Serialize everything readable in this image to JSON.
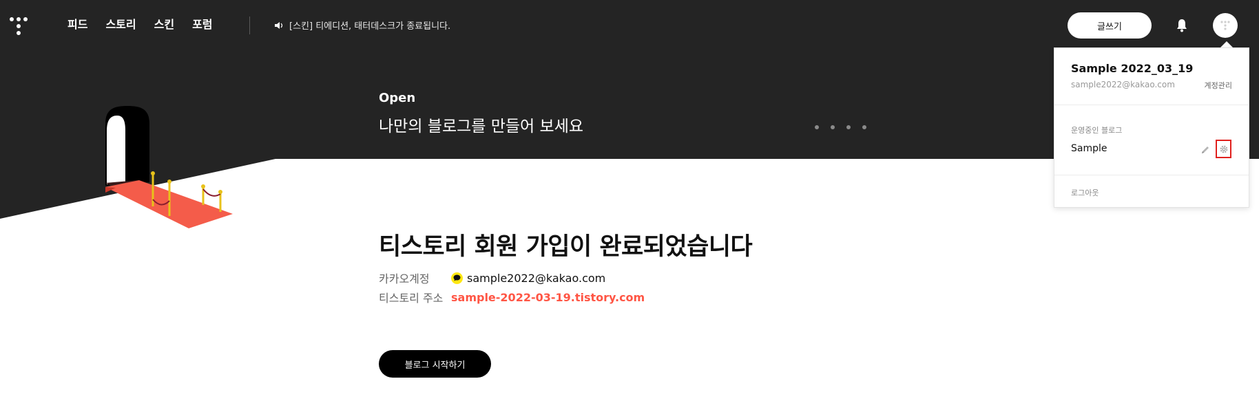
{
  "nav": {
    "items": [
      "피드",
      "스토리",
      "스킨",
      "포럼"
    ]
  },
  "notice": {
    "text": "[스킨] 티에디션, 태터데스크가 종료됩니다."
  },
  "header": {
    "write_label": "글쓰기"
  },
  "hero": {
    "kicker": "Open",
    "title": "나만의 블로그를 만들어 보세요"
  },
  "main": {
    "title": "티스토리 회원 가입이 완료되었습니다",
    "kakao_label": "카카오계정",
    "kakao_value": "sample2022@kakao.com",
    "address_label": "티스토리 주소",
    "address_value": "sample-2022-03-19.tistory.com",
    "start_label": "블로그 시작하기"
  },
  "dropdown": {
    "user_name": "Sample 2022_03_19",
    "user_email": "sample2022@kakao.com",
    "manage_label": "계정관리",
    "section_label": "운영중인 블로그",
    "blog_name": "Sample",
    "logout_label": "로그아웃"
  },
  "icons": {
    "logo": "tistory-logo-icon",
    "speaker": "speaker-icon",
    "bell": "bell-icon",
    "profile": "profile-icon",
    "pencil": "pencil-icon",
    "gear": "gear-icon",
    "kakao": "kakao-icon"
  },
  "colors": {
    "hero_background": "#242424",
    "accent": "#ff5544",
    "highlight_border": "#e0201d",
    "kakao_yellow": "#ffe812"
  }
}
